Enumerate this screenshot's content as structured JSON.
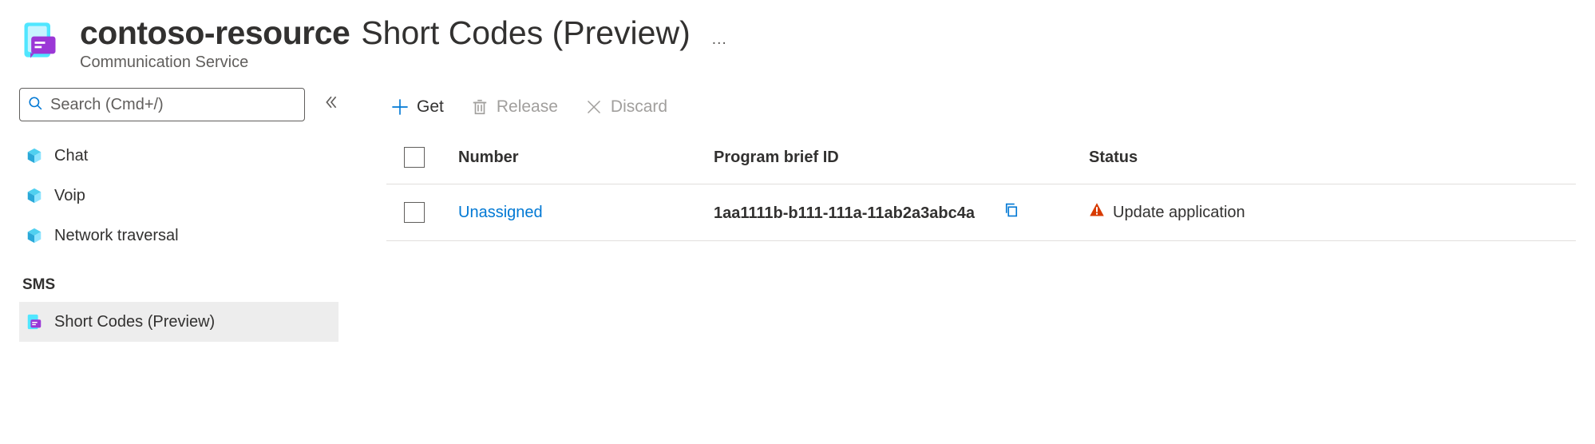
{
  "header": {
    "resource_name": "contoso-resource",
    "page_title": "Short Codes (Preview)",
    "service_name": "Communication Service",
    "more": "…"
  },
  "sidebar": {
    "search_placeholder": "Search (Cmd+/)",
    "items": [
      {
        "label": "Chat"
      },
      {
        "label": "Voip"
      },
      {
        "label": "Network traversal"
      }
    ],
    "section_label": "SMS",
    "selected_item_label": "Short Codes (Preview)"
  },
  "toolbar": {
    "get_label": "Get",
    "release_label": "Release",
    "discard_label": "Discard"
  },
  "table": {
    "columns": {
      "number": "Number",
      "program_brief_id": "Program brief ID",
      "status": "Status"
    },
    "rows": [
      {
        "number": "Unassigned",
        "program_brief_id": "1aa1111b-b111-111a-11ab2a3abc4a",
        "status": "Update application"
      }
    ]
  }
}
